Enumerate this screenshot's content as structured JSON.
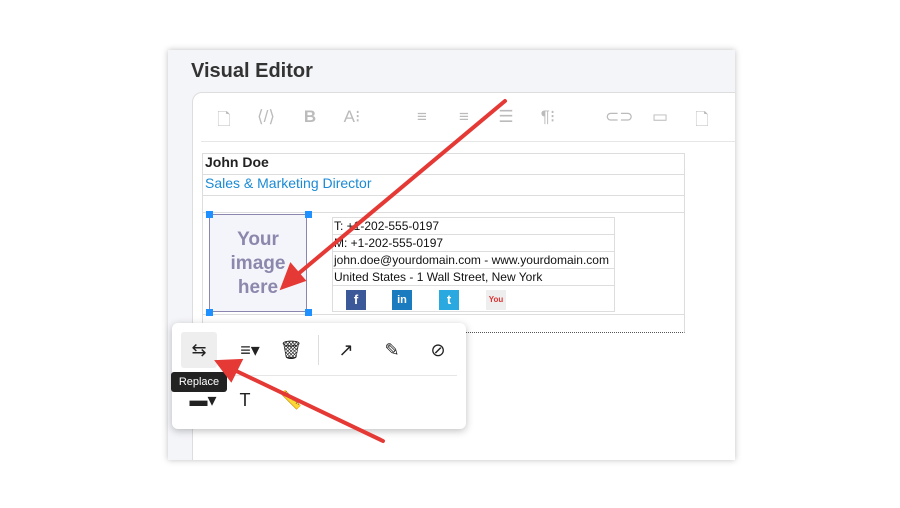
{
  "title": "Visual Editor",
  "toolbar": [
    "file-icon",
    "code-view-icon",
    "bold-icon",
    "font-size-icon",
    "align-left-icon",
    "align-center-icon",
    "ordered-list-icon",
    "paragraph-format-icon",
    "link-icon",
    "image-icon",
    "image-manager-icon"
  ],
  "signature": {
    "name": "John Doe",
    "job_title": "Sales & Marketing Director",
    "image_placeholder": "Your image here",
    "phone": "T: +1-202-555-0197",
    "mobile": "M: +1-202-555-0197",
    "email": "john.doe@yourdomain.com - ",
    "website": "www.yourdomain.com",
    "address": "United States - 1 Wall Street, New York",
    "social": [
      "facebook",
      "linkedin",
      "twitter",
      "youtube"
    ],
    "accent": "#1a8ad4"
  },
  "image_popup": {
    "row1": [
      "replace",
      "align",
      "remove",
      "open-link",
      "edit-alt",
      "unlink"
    ],
    "row2": [
      "display",
      "alternative-text",
      "change-size"
    ],
    "tooltip": "Replace"
  },
  "annotation_color": "#e53935"
}
